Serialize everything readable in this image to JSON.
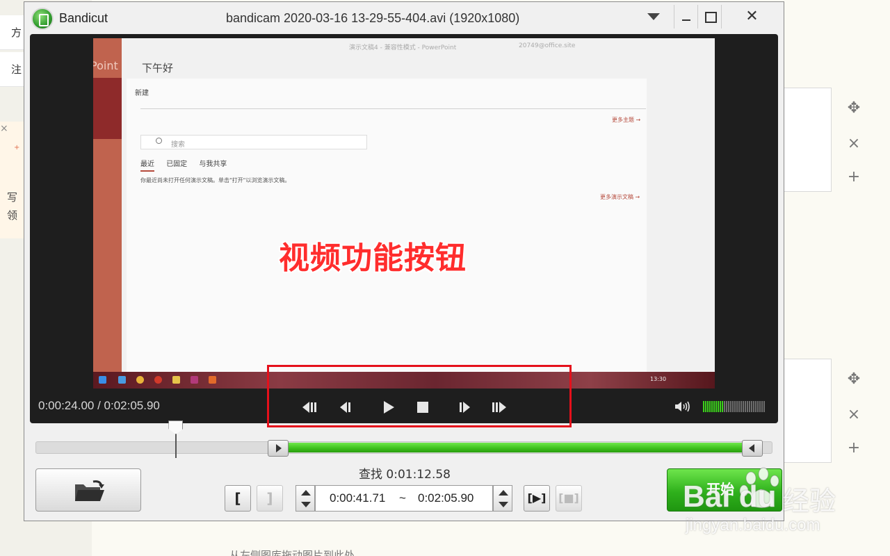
{
  "background": {
    "tabs": [
      "方",
      "注"
    ],
    "note_lines": [
      "写",
      "领"
    ],
    "note_close": "×",
    "hint": "从左侧图库拖动图片到此处",
    "tools": [
      "✥",
      "×",
      "+"
    ]
  },
  "window": {
    "app_name": "Bandicut",
    "file_title": "bandicam 2020-03-16 13-29-55-404.avi (1920x1080)",
    "close_glyph": "✕"
  },
  "video": {
    "side_label": "Point",
    "window_caption": "演示文稿4 - 兼容性模式 - PowerPoint",
    "user": "20749@office.site",
    "greeting": "下午好",
    "section_new": "新建",
    "more_themes": "更多主题 →",
    "search_placeholder": "搜索",
    "tabs": [
      "最近",
      "已固定",
      "与我共享"
    ],
    "recent_text": "你最近尚未打开任何演示文稿。单击\"打开\"以浏览演示文稿。",
    "more_files": "更多演示文稿 →",
    "taskbar_time": "13:30",
    "overlay_caption": "视频功能按钮"
  },
  "player": {
    "time_display": "0:00:24.00 / 0:02:05.90",
    "controls": [
      "prev-keyframe-icon",
      "prev-frame-icon",
      "play-icon",
      "stop-icon",
      "next-frame-icon",
      "next-keyframe-icon"
    ],
    "volume_icon": "speaker-icon",
    "volume_level": 0.33
  },
  "timeline": {
    "playhead_fraction": 0.19,
    "selection_start_fraction": 0.33,
    "selection_end_fraction": 1.0
  },
  "bottom": {
    "seek_label": "查找 0:01:12.58",
    "set_start": "[",
    "set_end": "]",
    "range_start": "0:00:41.71",
    "range_sep": "~",
    "range_end": "0:02:05.90",
    "play_range": "[▶]",
    "stop_range": "[■]",
    "start_button": "开始"
  },
  "watermark": {
    "brand": "Bai du",
    "cn": "经验",
    "url": "jingyan.baidu.com"
  },
  "colors": {
    "accent_green": "#3bbf1a",
    "highlight_red": "#e5101b",
    "overlay_red": "#ff2d2d"
  }
}
